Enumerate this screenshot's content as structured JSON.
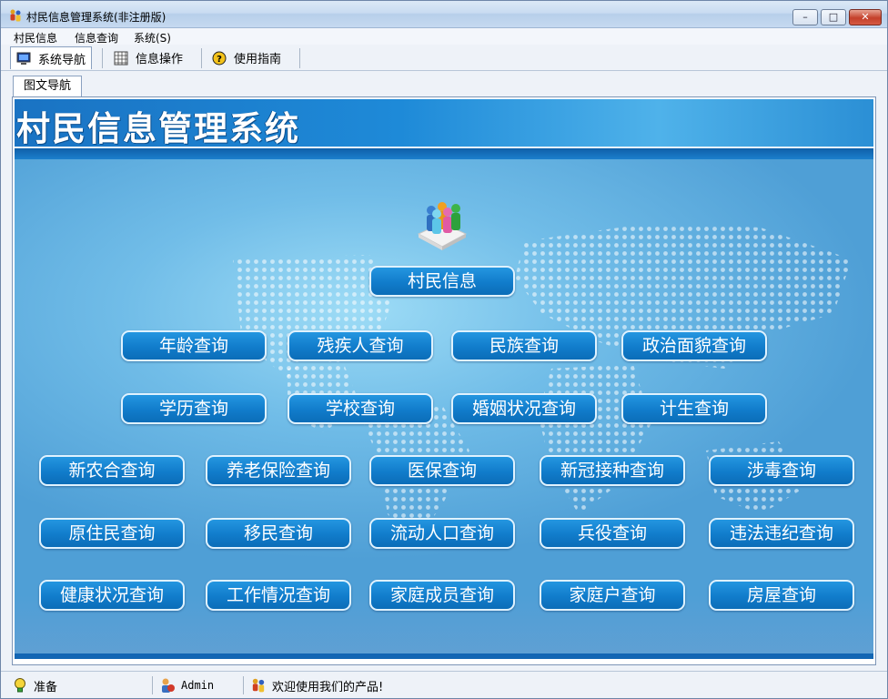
{
  "window": {
    "title": "村民信息管理系统(非注册版)",
    "controls": {
      "minimize": "–",
      "maximize": "□",
      "close": "✕"
    }
  },
  "menu": [
    {
      "label": "村民信息"
    },
    {
      "label": "信息查询"
    },
    {
      "label": "系统(S)"
    }
  ],
  "toolbar": {
    "tabs": [
      {
        "label": "系统导航",
        "icon": "monitor-icon"
      },
      {
        "label": "信息操作",
        "icon": "grid-icon"
      },
      {
        "label": "使用指南",
        "icon": "help-icon"
      }
    ]
  },
  "doc_tab": {
    "label": "图文导航"
  },
  "banner": {
    "title": "村民信息管理系统"
  },
  "nav": {
    "main": "村民信息",
    "row1": [
      "年龄查询",
      "残疾人查询",
      "民族查询",
      "政治面貌查询"
    ],
    "row2": [
      "学历查询",
      "学校查询",
      "婚姻状况查询",
      "计生查询"
    ],
    "row3": [
      "新农合查询",
      "养老保险查询",
      "医保查询",
      "新冠接种查询",
      "涉毒查询"
    ],
    "row4": [
      "原住民查询",
      "移民查询",
      "流动人口查询",
      "兵役查询",
      "违法违纪查询"
    ],
    "row5": [
      "健康状况查询",
      "工作情况查询",
      "家庭成员查询",
      "家庭户查询",
      "房屋查询"
    ]
  },
  "status": {
    "ready": "准备",
    "user": "Admin",
    "welcome": "欢迎使用我们的产品!"
  },
  "colors": {
    "button": "#117ccb",
    "banner": "#1a73c3",
    "stage": "#71bde8"
  }
}
